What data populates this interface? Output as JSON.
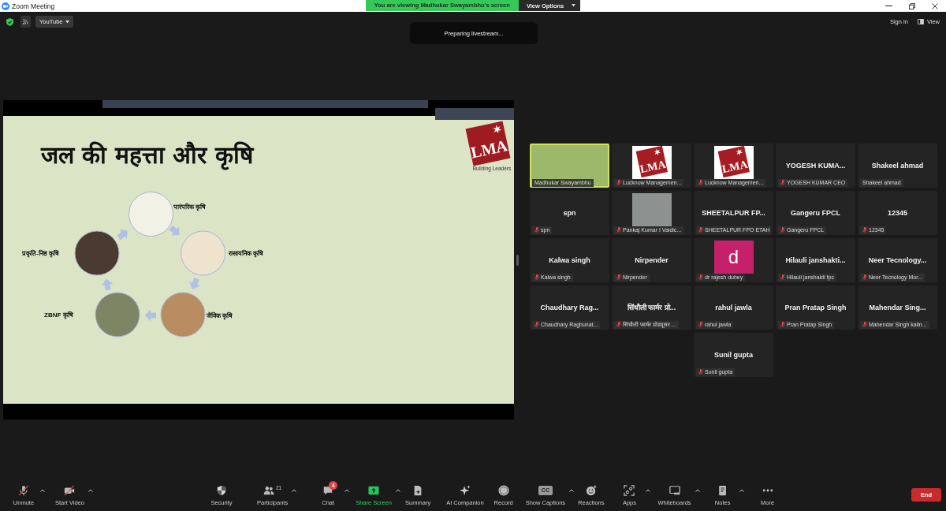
{
  "window": {
    "title": "Zoom Meeting"
  },
  "banner": {
    "text": "You are viewing Madhukar Swayambhu's screen",
    "button": "View Options"
  },
  "top_bar": {
    "livestream_menu": "YouTube",
    "status": "Preparing livestream...",
    "sign_in": "Sign in",
    "view": "View"
  },
  "shared_screen": {
    "title": "जल की महत्ता और कृषि",
    "logo": "LMA",
    "logo_tagline": "Building Leaders",
    "cycle": [
      {
        "label": "पारंपरिक कृषि"
      },
      {
        "label": "प्रकृति-निष्ठ कृषि"
      },
      {
        "label": "रासायनिक कृषि"
      },
      {
        "label": "ZBNF कृषि"
      },
      {
        "label": "जैविक कृषि"
      }
    ]
  },
  "participants": [
    {
      "kind": "video",
      "label": "Madhukar Swayambhu",
      "muted": false,
      "speaking": true
    },
    {
      "kind": "logo",
      "logo_text": "LMA",
      "label": "Lucknow Managemen...",
      "muted": true,
      "speaking": false
    },
    {
      "kind": "logo",
      "logo_text": "LMA",
      "label": "Lucknow Managemen...",
      "muted": true,
      "speaking": false
    },
    {
      "kind": "name",
      "tile_name": "YOGESH KUMA...",
      "label": "YOGESH KUMAR CEO",
      "muted": true,
      "speaking": false
    },
    {
      "kind": "name",
      "tile_name": "Shakeel ahmad",
      "label": "Shakeel ahmad",
      "muted": false,
      "speaking": false
    },
    {
      "kind": "name",
      "tile_name": "spn",
      "label": "spn",
      "muted": true,
      "speaking": false
    },
    {
      "kind": "photo",
      "label": "Pankaj Kumar I Vaidic...",
      "muted": true,
      "speaking": false
    },
    {
      "kind": "name",
      "tile_name": "SHEETALPUR FP...",
      "label": "SHEETALPUR FPO ETAH",
      "muted": true,
      "speaking": false
    },
    {
      "kind": "name",
      "tile_name": "Gangeru FPCL",
      "label": "Gangeru FPCL",
      "muted": true,
      "speaking": false
    },
    {
      "kind": "name",
      "tile_name": "12345",
      "label": "12345",
      "muted": true,
      "speaking": false
    },
    {
      "kind": "name",
      "tile_name": "Kalwa singh",
      "label": "Kalwa singh",
      "muted": true,
      "speaking": false
    },
    {
      "kind": "name",
      "tile_name": "Nirpender",
      "label": "Nirpender",
      "muted": true,
      "speaking": false
    },
    {
      "kind": "avatar",
      "avatar_letter": "d",
      "label": "dr rajesh dubey",
      "muted": true,
      "speaking": false
    },
    {
      "kind": "name",
      "tile_name": "Hilauli janshakti...",
      "label": "Hilauli janshakti fpc",
      "muted": true,
      "speaking": false
    },
    {
      "kind": "name",
      "tile_name": "Neer Tecnology...",
      "label": "Neer Tecnology Mor...",
      "muted": true,
      "speaking": false
    },
    {
      "kind": "name",
      "tile_name": "Chaudhary Rag...",
      "label": "Chaudhary Raghunat...",
      "muted": true,
      "speaking": false
    },
    {
      "kind": "name",
      "tile_name": "सिंधौली फार्मर प्रो...",
      "label": "सिंधौली फार्मर प्रोड्यूसर ...",
      "muted": true,
      "speaking": false
    },
    {
      "kind": "name",
      "tile_name": "rahul jawla",
      "label": "rahul jawla",
      "muted": true,
      "speaking": false
    },
    {
      "kind": "name",
      "tile_name": "Pran Pratap Singh",
      "label": "Pran Pratap Singh",
      "muted": true,
      "speaking": false
    },
    {
      "kind": "name",
      "tile_name": "Mahendar Sing...",
      "label": "Mahendar Singh kalin...",
      "muted": true,
      "speaking": false
    },
    {
      "kind": "name",
      "tile_name": "Sunil gupta",
      "label": "Sunil gupta",
      "muted": true,
      "speaking": false
    }
  ],
  "toolbar": [
    {
      "label": "Unmute",
      "off": true,
      "caret": true,
      "highlighted": false
    },
    {
      "label": "Start Video",
      "off": true,
      "caret": true,
      "highlighted": false
    },
    {
      "label": "Security",
      "off": false,
      "caret": false,
      "highlighted": false
    },
    {
      "label": "Participants",
      "count": "21",
      "off": false,
      "caret": true,
      "highlighted": false
    },
    {
      "label": "Chat",
      "badge": "4",
      "off": false,
      "caret": true,
      "highlighted": false
    },
    {
      "label": "Share Screen",
      "off": false,
      "caret": true,
      "highlighted": true
    },
    {
      "label": "Summary",
      "off": false,
      "caret": false,
      "highlighted": false
    },
    {
      "label": "AI Companion",
      "off": false,
      "caret": false,
      "highlighted": false
    },
    {
      "label": "Record",
      "off": false,
      "caret": false,
      "highlighted": false
    },
    {
      "label": "Show Captions",
      "icon_text": "CC",
      "off": false,
      "caret": true,
      "highlighted": false
    },
    {
      "label": "Reactions",
      "off": false,
      "caret": false,
      "highlighted": false
    },
    {
      "label": "Apps",
      "off": false,
      "caret": true,
      "highlighted": false
    },
    {
      "label": "Whiteboards",
      "off": false,
      "caret": true,
      "highlighted": false
    },
    {
      "label": "Notes",
      "off": false,
      "caret": true,
      "highlighted": false
    },
    {
      "label": "More",
      "off": false,
      "caret": false,
      "highlighted": false
    }
  ],
  "end_button": "End"
}
